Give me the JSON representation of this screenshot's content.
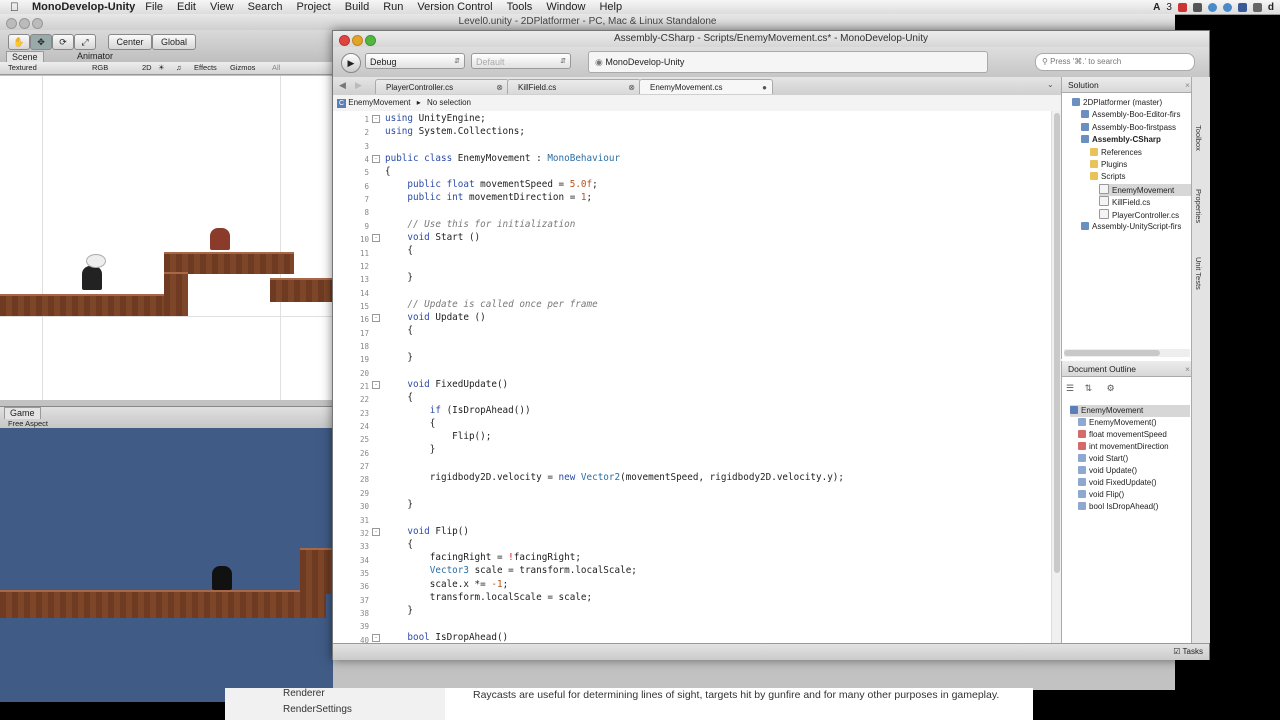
{
  "menubar": {
    "app_name": "MonoDevelop-Unity",
    "items": [
      "File",
      "Edit",
      "View",
      "Search",
      "Project",
      "Build",
      "Run",
      "Version Control",
      "Tools",
      "Window",
      "Help"
    ],
    "tray_text": "3"
  },
  "unity": {
    "title": "Level0.unity - 2DPlatformer - PC, Mac & Linux Standalone",
    "pivot_center": "Center",
    "pivot_global": "Global",
    "scene_tab": "Scene",
    "animator_tab": "Animator",
    "shading_mode": "Textured",
    "render_mode": "RGB",
    "mode_2d": "2D",
    "effects": "Effects",
    "gizmos": "Gizmos",
    "search_all": "All",
    "game_tab": "Game",
    "aspect": "Free Aspect",
    "docs_items": [
      "Renderer",
      "RenderSettings"
    ],
    "docs_text": "Raycasts are useful for determining lines of sight, targets hit by gunfire and for many other purposes in gameplay."
  },
  "md": {
    "title": "Assembly-CSharp - Scripts/EnemyMovement.cs* - MonoDevelop-Unity",
    "config": "Debug",
    "platform": "Default",
    "status": "MonoDevelop-Unity",
    "search_placeholder": "Press '⌘.' to search",
    "tabs": [
      "PlayerController.cs",
      "KillField.cs",
      "EnemyMovement.cs"
    ],
    "breadcrumb_class": "EnemyMovement",
    "breadcrumb_member": "No selection",
    "solution_title": "Solution",
    "solution_tree": [
      {
        "label": "2DPlatformer (master)",
        "depth": 0
      },
      {
        "label": "Assembly-Boo-Editor-firs",
        "depth": 1
      },
      {
        "label": "Assembly-Boo-firstpass",
        "depth": 1
      },
      {
        "label": "Assembly-CSharp",
        "depth": 1
      },
      {
        "label": "References",
        "depth": 2
      },
      {
        "label": "Plugins",
        "depth": 2
      },
      {
        "label": "Scripts",
        "depth": 2
      },
      {
        "label": "EnemyMovement",
        "depth": 3
      },
      {
        "label": "KillField.cs",
        "depth": 3
      },
      {
        "label": "PlayerController.cs",
        "depth": 3
      },
      {
        "label": "Assembly-UnityScript-firs",
        "depth": 1
      }
    ],
    "outline_title": "Document Outline",
    "outline_items": [
      "EnemyMovement",
      "EnemyMovement()",
      "float movementSpeed",
      "int movementDirection",
      "void Start()",
      "void Update()",
      "void FixedUpdate()",
      "void Flip()",
      "bool IsDropAhead()"
    ],
    "side_tabs": [
      "Toolbox",
      "Properties",
      "Unit Tests"
    ],
    "tasks": "Tasks"
  },
  "code_lines": [
    "1",
    "2",
    "3",
    "4",
    "5",
    "6",
    "7",
    "8",
    "9",
    "10",
    "11",
    "12",
    "13",
    "14",
    "15",
    "16",
    "17",
    "18",
    "19",
    "20",
    "21",
    "22",
    "23",
    "24",
    "25",
    "26",
    "27",
    "28",
    "29",
    "30",
    "31",
    "32",
    "33",
    "34",
    "35",
    "36",
    "37",
    "38",
    "39",
    "40"
  ]
}
